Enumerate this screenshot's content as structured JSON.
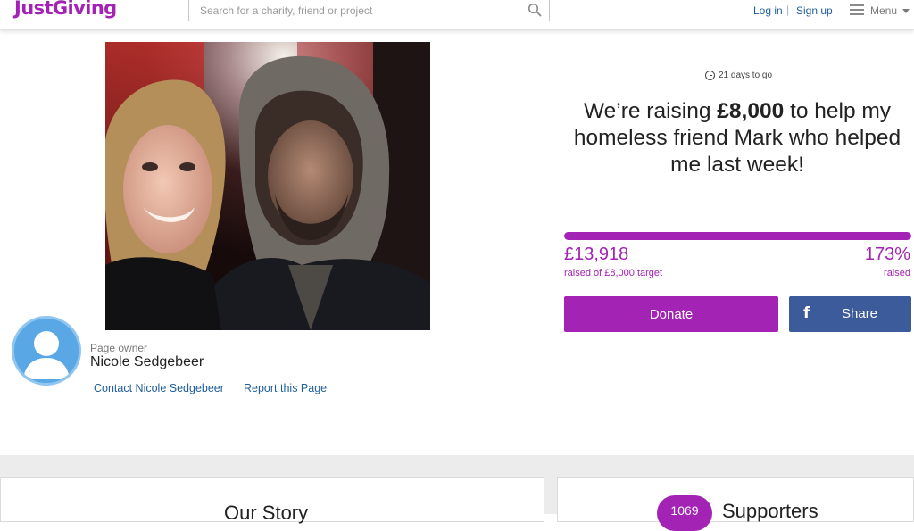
{
  "header": {
    "logo": "JustGiving",
    "logo_tm": "™",
    "search_placeholder": "Search for a charity, friend or project",
    "login": "Log in",
    "separator": "|",
    "signup": "Sign up",
    "menu": "Menu"
  },
  "owner": {
    "caption": "Page owner",
    "name": "Nicole Sedgebeer",
    "contact": "Contact Nicole Sedgebeer",
    "report": "Report this Page"
  },
  "campaign": {
    "days_left": "21 days to go",
    "headline_pre": "We’re raising ",
    "headline_amount": "£8,000",
    "headline_post": " to help my homeless friend Mark who helped me last week!",
    "raised_amount": "£13,918",
    "raised_target": "raised of £8,000 target",
    "percent": "173%",
    "percent_label": "raised",
    "progress_fraction": 1.0
  },
  "actions": {
    "donate": "Donate",
    "share_icon": "f",
    "share": "Share"
  },
  "sections": {
    "story_title": "Our Story",
    "supporters_count": "1069",
    "supporters_title": "Supporters"
  },
  "colors": {
    "brand_purple": "#a323b4",
    "facebook_blue": "#3b5b9a",
    "link_blue": "#1f5e9c"
  },
  "icons": {
    "search": "search-icon",
    "menu": "hamburger-icon",
    "clock": "clock-icon",
    "facebook": "facebook-icon",
    "avatar": "avatar-placeholder-icon"
  }
}
